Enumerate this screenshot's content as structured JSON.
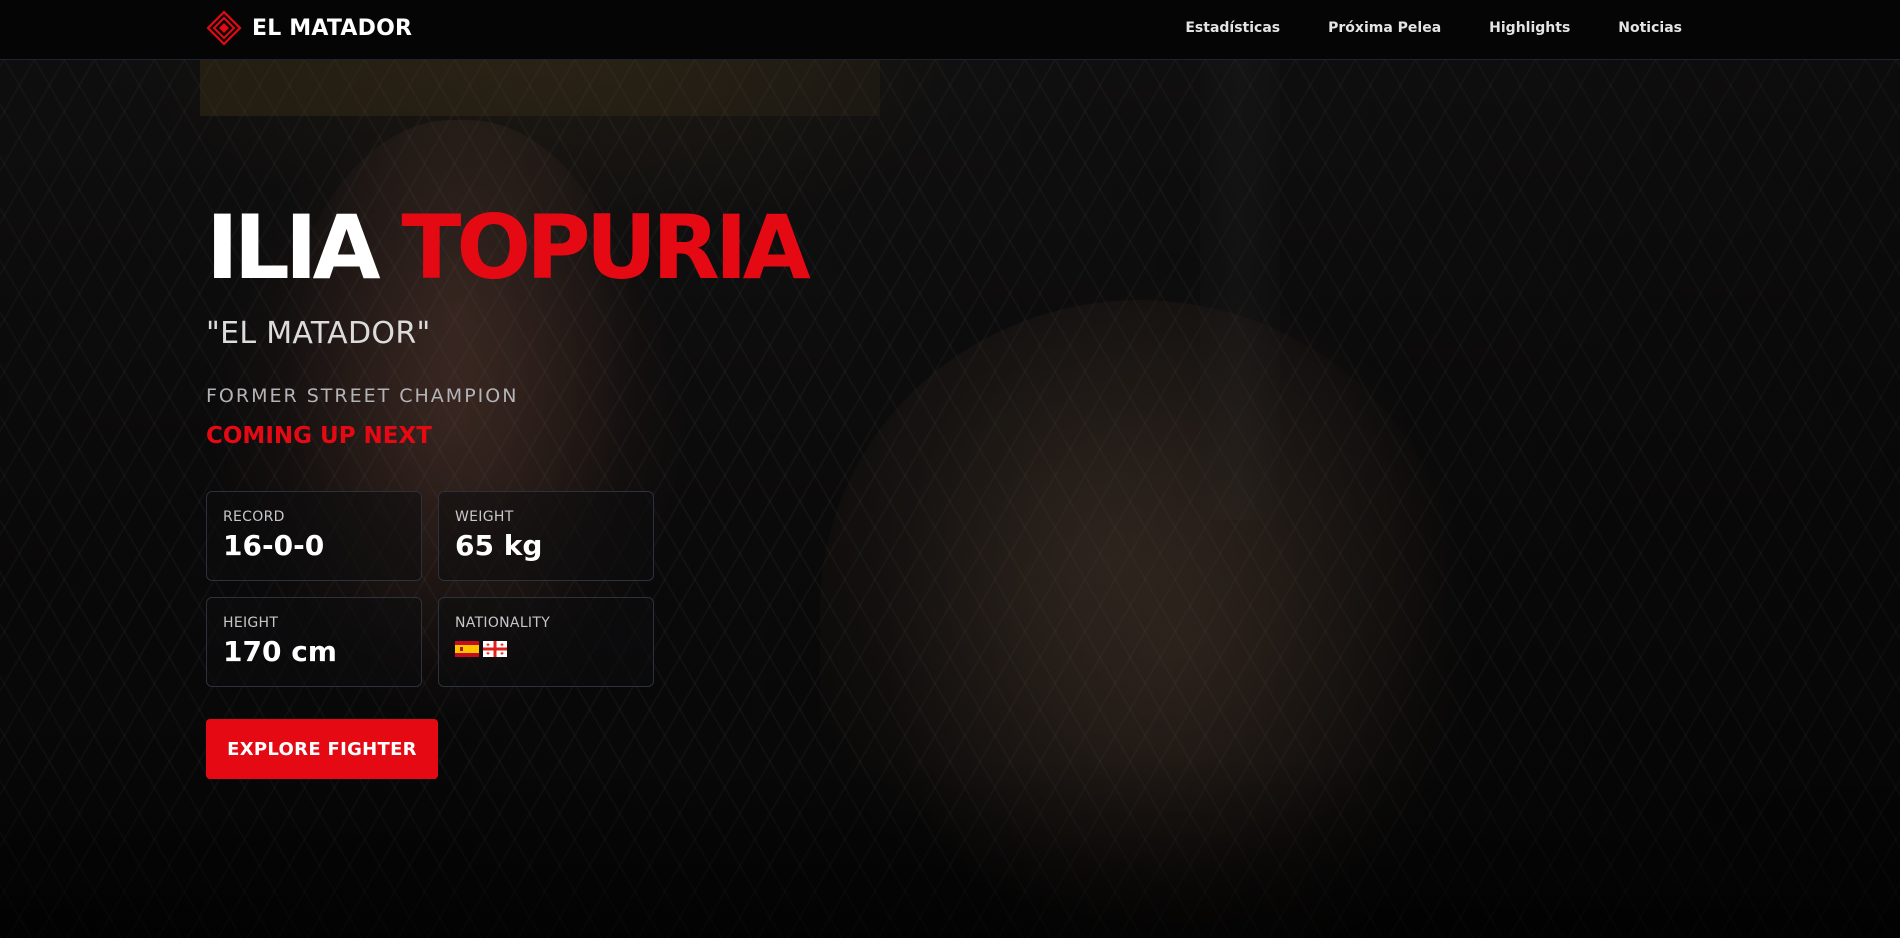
{
  "brand": {
    "name": "EL MATADOR",
    "logo_icon": "diamond-logo-icon",
    "accent": "#e50914"
  },
  "nav": {
    "items": [
      {
        "label": "Estadísticas"
      },
      {
        "label": "Próxima Pelea"
      },
      {
        "label": "Highlights"
      },
      {
        "label": "Noticias"
      }
    ]
  },
  "hero": {
    "first_name": "ILIA",
    "last_name": "TOPURIA",
    "nickname": "\"EL MATADOR\"",
    "subtitle": "FORMER STREET CHAMPION",
    "status": "COMING UP NEXT",
    "stats": {
      "record": {
        "label": "RECORD",
        "value": "16-0-0"
      },
      "weight": {
        "label": "WEIGHT",
        "value": "65 kg"
      },
      "height": {
        "label": "HEIGHT",
        "value": "170 cm"
      },
      "nationality": {
        "label": "NATIONALITY",
        "flags": [
          "spain-flag-icon",
          "georgia-flag-icon"
        ]
      }
    },
    "cta_label": "EXPLORE FIGHTER"
  },
  "colors": {
    "accent_red": "#e50914",
    "background": "#060607",
    "card_border": "#2c313c",
    "nav_border": "#1d2330"
  }
}
